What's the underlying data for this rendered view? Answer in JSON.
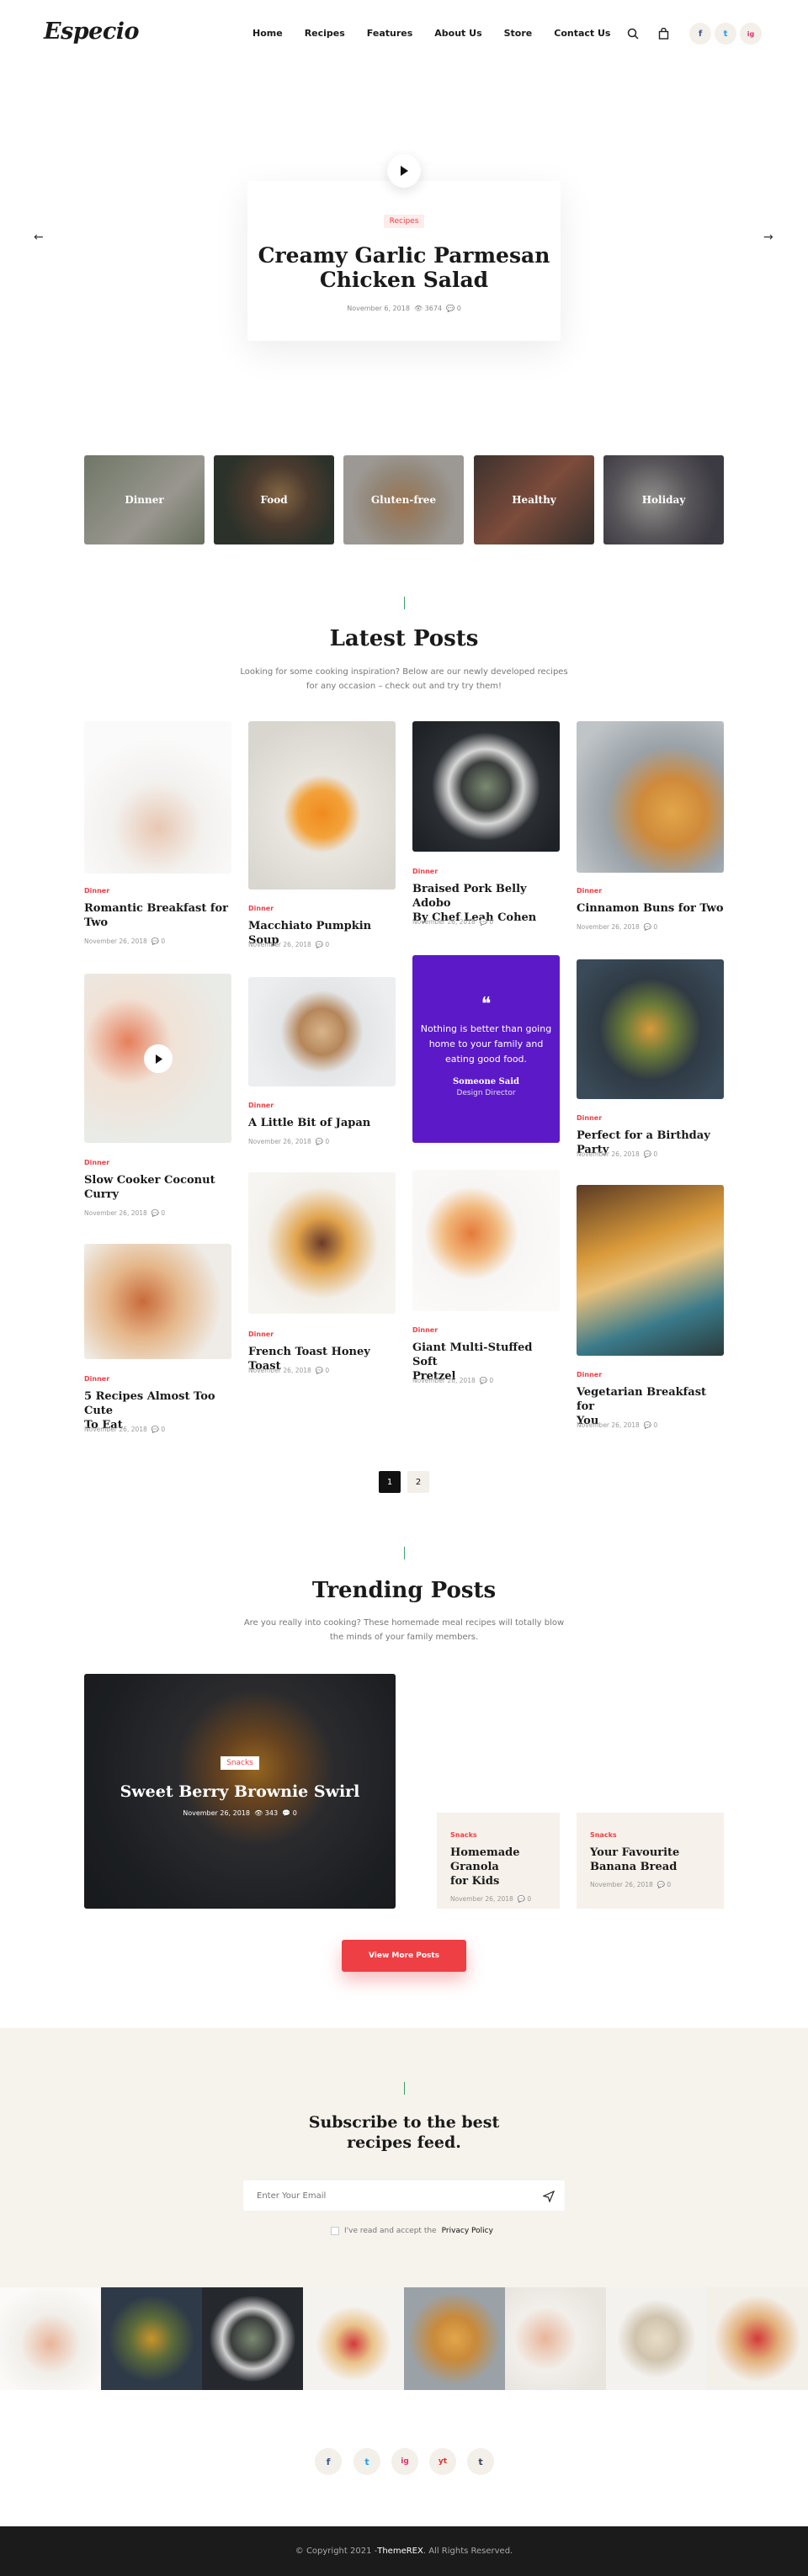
{
  "header": {
    "logo": "Especio",
    "nav": [
      "Home",
      "Recipes",
      "Features",
      "About Us",
      "Store",
      "Contact Us"
    ],
    "icons": [
      "search-icon",
      "bag-icon"
    ],
    "social": [
      {
        "icon": "f",
        "color": "#3b5998"
      },
      {
        "icon": "t",
        "color": "#1da1f2"
      },
      {
        "icon": "ig",
        "color": "#e1306c"
      }
    ]
  },
  "hero": {
    "tag": "Recipes",
    "title_line1": "Creamy Garlic Parmesan",
    "title_line2": "Chicken Salad",
    "date": "November 6, 2018",
    "views": "3674",
    "comments": "0",
    "prev": "←",
    "next": "→"
  },
  "categories": [
    "Dinner",
    "Food",
    "Gluten-free",
    "Healthy",
    "Holiday"
  ],
  "latest": {
    "title": "Latest Posts",
    "subtitle_line1": "Looking for some cooking inspiration? Below are our newly developed recipes",
    "subtitle_line2": "for any occasion – check out and try try them!",
    "posts": [
      {
        "cat": "Dinner",
        "title1": "Romantic Breakfast for",
        "title2": "Two",
        "date": "November 26, 2018",
        "comments": "0"
      },
      {
        "cat": "Dinner",
        "title1": "Macchiato Pumpkin Soup",
        "title2": "",
        "date": "November 26, 2018",
        "comments": "0"
      },
      {
        "cat": "Dinner",
        "title1": "Braised Pork Belly Adobo",
        "title2": "By Chef Leah Cohen",
        "date": "November 26, 2018",
        "comments": "0"
      },
      {
        "cat": "Dinner",
        "title1": "Cinnamon Buns for Two",
        "title2": "",
        "date": "November 26, 2018",
        "comments": "0"
      },
      {
        "cat": "Dinner",
        "title1": "Slow Cooker Coconut",
        "title2": "Curry",
        "date": "November 26, 2018",
        "comments": "0"
      },
      {
        "cat": "Dinner",
        "title1": "A Little Bit of Japan",
        "title2": "",
        "date": "November 26, 2018",
        "comments": "0"
      },
      {
        "cat": "Dinner",
        "title1": "Perfect for a Birthday Party",
        "title2": "",
        "date": "November 26, 2018",
        "comments": "0"
      },
      {
        "cat": "Dinner",
        "title1": "5 Recipes Almost Too Cute",
        "title2": "To Eat",
        "date": "November 26, 2018",
        "comments": "0"
      },
      {
        "cat": "Dinner",
        "title1": "French Toast Honey Toast",
        "title2": "",
        "date": "November 26, 2018",
        "comments": "0"
      },
      {
        "cat": "Dinner",
        "title1": "Giant Multi-Stuffed Soft",
        "title2": "Pretzel",
        "date": "November 26, 2018",
        "comments": "0"
      },
      {
        "cat": "Dinner",
        "title1": "Vegetarian Breakfast for",
        "title2": "You",
        "date": "November 26, 2018",
        "comments": "0"
      }
    ],
    "quote": {
      "mark": "❝",
      "line1": "Nothing is better than going",
      "line2": "home to your family and",
      "line3": "eating good food.",
      "author": "Someone Said",
      "role": "Design Director"
    },
    "pages": [
      "1",
      "2"
    ]
  },
  "trending": {
    "title": "Trending Posts",
    "subtitle_line1": "Are you really into cooking? These homemade meal recipes will totally blow",
    "subtitle_line2": "the minds of your family members.",
    "feature": {
      "tag": "Snacks",
      "title": "Sweet Berry Brownie Swirl",
      "date": "November 26, 2018",
      "views": "343",
      "comments": "0"
    },
    "cards": [
      {
        "cat": "Snacks",
        "title1": "Homemade Granola",
        "title2": "for Kids",
        "date": "November 26, 2018",
        "comments": "0"
      },
      {
        "cat": "Snacks",
        "title1": "Your Favourite",
        "title2": "Banana Bread",
        "date": "November 26, 2018",
        "comments": "0"
      }
    ],
    "button": "View More Posts"
  },
  "subscribe": {
    "title_line1": "Subscribe to the best",
    "title_line2": "recipes feed.",
    "placeholder": "Enter Your Email",
    "consent": "I've read and accept the",
    "policy": "Privacy Policy"
  },
  "footer_social": [
    "f",
    "t",
    "ig",
    "yt",
    "t"
  ],
  "footer": {
    "copyright_pre": "© Copyright 2021 - ",
    "brand": "ThemeREX",
    "copyright_post": ". All Rights Reserved."
  },
  "accent": "#ee3f45",
  "quote_bg": "#5b19c8"
}
